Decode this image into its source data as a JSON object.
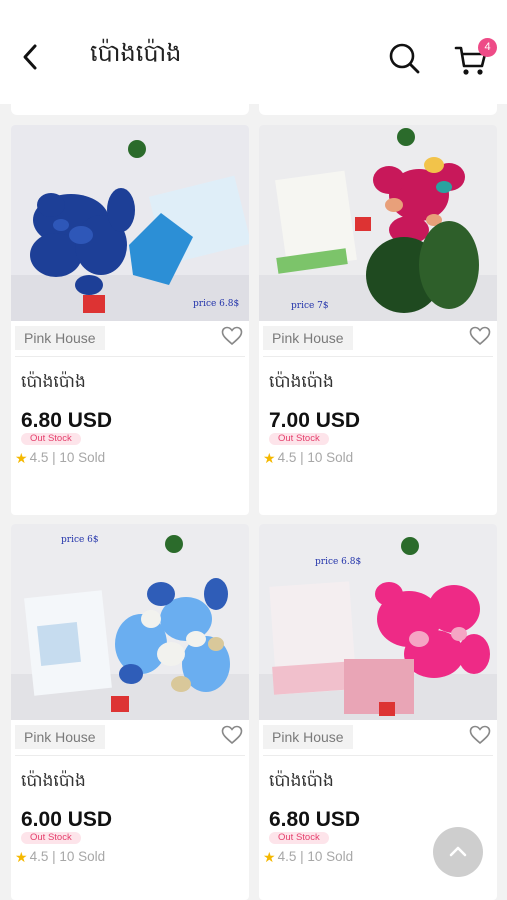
{
  "header": {
    "title": "ប៉ោងប៉ោង",
    "cart_count": "4"
  },
  "colors": {
    "accent_pink": "#ee4b87",
    "out_stock_text": "#e5406d",
    "star": "#f5b800"
  },
  "icons": {
    "back": "chevron-left-icon",
    "search": "search-icon",
    "cart": "cart-icon",
    "favorite": "heart-outline-icon",
    "rating": "star-icon",
    "scroll_top": "chevron-up-icon"
  },
  "products": [
    {
      "shop": "Pink House",
      "name": "ប៉ោងប៉ោង",
      "price": "6.80 USD",
      "stock": "Out Stock",
      "rating": "4.5 | 10 Sold",
      "image_price_label": "price 6.8$",
      "theme": "blue"
    },
    {
      "shop": "Pink House",
      "name": "ប៉ោងប៉ោង",
      "price": "7.00 USD",
      "stock": "Out Stock",
      "rating": "4.5 | 10 Sold",
      "image_price_label": "price 7$",
      "theme": "red"
    },
    {
      "shop": "Pink House",
      "name": "ប៉ោងប៉ោង",
      "price": "6.00 USD",
      "stock": "Out Stock",
      "rating": "4.5 | 10 Sold",
      "image_price_label": "price 6$",
      "theme": "lightblue"
    },
    {
      "shop": "Pink House",
      "name": "ប៉ោងប៉ោង",
      "price": "6.80 USD",
      "stock": "Out Stock",
      "rating": "4.5 | 10 Sold",
      "image_price_label": "price 6.8$",
      "theme": "pink"
    }
  ]
}
